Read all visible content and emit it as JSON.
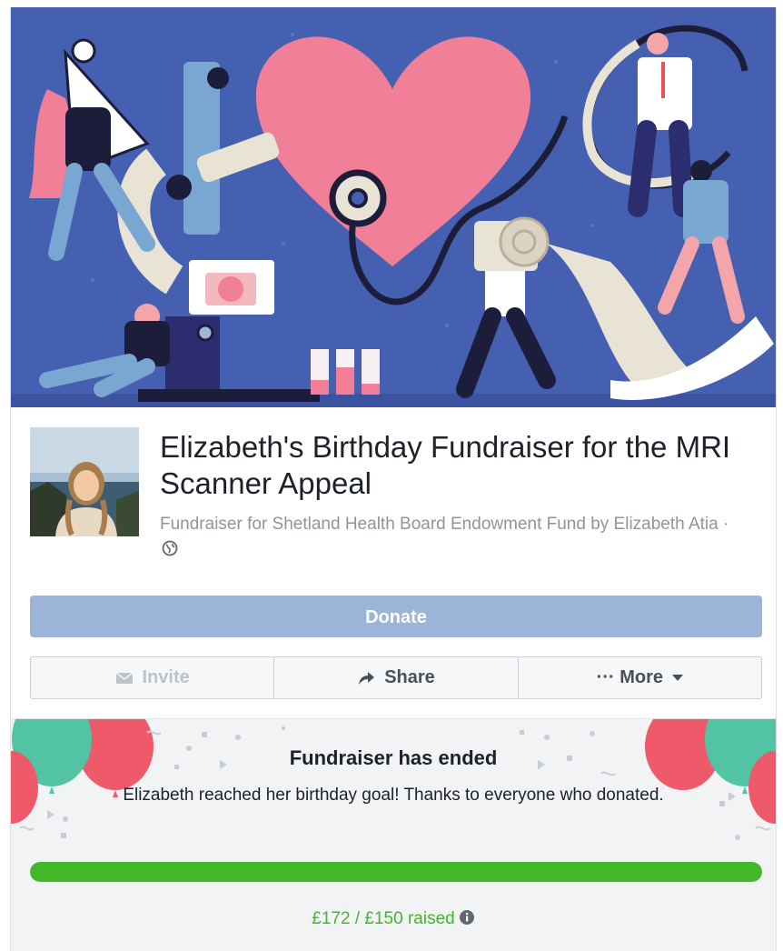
{
  "fundraiser": {
    "title": "Elizabeth's Birthday Fundraiser for the MRI Scanner Appeal",
    "subtitle": "Fundraiser for Shetland Health Board Endowment Fund by Elizabeth Atia · ",
    "privacy_icon": "globe-icon"
  },
  "actions": {
    "donate_label": "Donate",
    "invite_label": "Invite",
    "invite_icon": "envelope-icon",
    "share_label": "Share",
    "share_icon": "share-arrow-icon",
    "more_label": "··· More",
    "more_icon": "caret-down-icon"
  },
  "status": {
    "title": "Fundraiser has ended",
    "message": "Elizabeth reached her birthday goal! Thanks to everyone who donated.",
    "raised_text": "£172 / £150 raised",
    "progress_fraction": 1.0,
    "info_icon": "info-icon"
  },
  "colors": {
    "cover_bg": "#4560b0",
    "donate_bg": "#9cb4d8",
    "progress_green": "#42b72a",
    "heart_pink": "#f07f97"
  }
}
